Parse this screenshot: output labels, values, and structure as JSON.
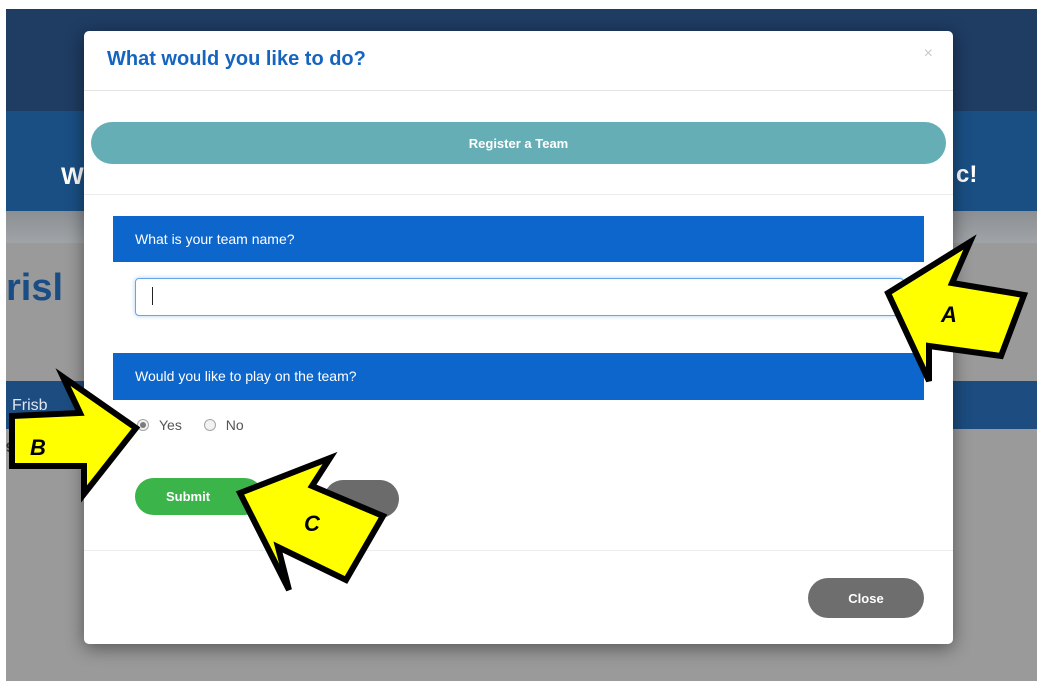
{
  "background": {
    "banner_left": "W",
    "banner_right": "c!",
    "title_fragment": "risl",
    "strip_text": "Frisb",
    "small_text": "9"
  },
  "modal": {
    "title": "What would you like to do?",
    "close_glyph": "×",
    "register_label": "Register a Team",
    "team_name_question": "What is your team name?",
    "team_name_value": "",
    "play_question": "Would you like to play on the team?",
    "radio_options": [
      {
        "label": "Yes",
        "checked": true
      },
      {
        "label": "No",
        "checked": false
      }
    ],
    "submit_label": "Submit",
    "secondary_label": "",
    "close_label": "Close"
  },
  "callouts": {
    "a": "A",
    "b": "B",
    "c": "C",
    "fill_color": "#ffff00",
    "stroke_color": "#000000"
  },
  "colors": {
    "title_blue": "#1565c0",
    "question_bar": "#0d66cc",
    "register_teal": "#65aeb6",
    "submit_green": "#3bb44a",
    "close_gray": "#6e6e6e"
  }
}
